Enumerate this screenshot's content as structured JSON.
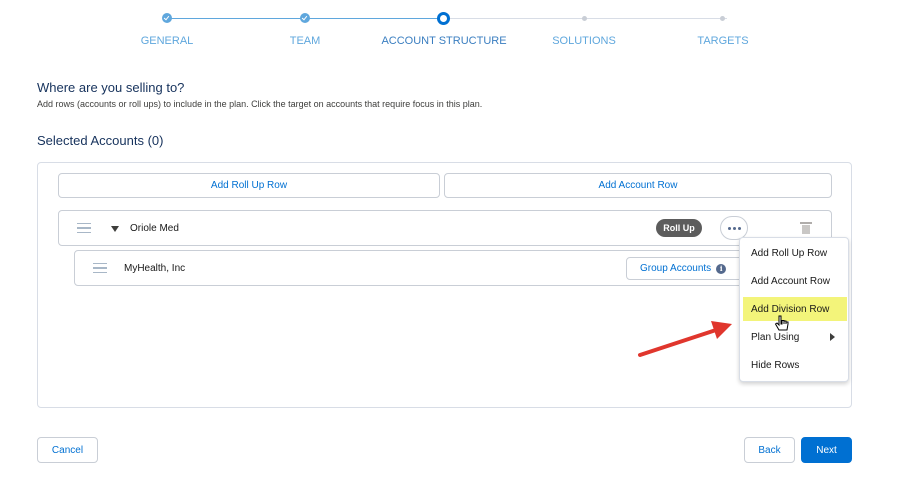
{
  "progress": {
    "steps": [
      {
        "label": "GENERAL",
        "state": "complete"
      },
      {
        "label": "TEAM",
        "state": "complete"
      },
      {
        "label": "ACCOUNT STRUCTURE",
        "state": "current"
      },
      {
        "label": "SOLUTIONS",
        "state": "incomplete"
      },
      {
        "label": "TARGETS",
        "state": "incomplete"
      }
    ]
  },
  "page": {
    "heading": "Where are you selling to?",
    "subtext": "Add rows (accounts or roll ups) to include in the plan. Click the target on accounts that require focus in this plan.",
    "selected_title": "Selected Accounts (0)"
  },
  "panel": {
    "add_rollup_label": "Add Roll Up Row",
    "add_account_label": "Add Account Row",
    "rows": [
      {
        "name": "Oriole Med",
        "badge": "Roll Up",
        "icon": "chevron-down-icon"
      },
      {
        "name": "MyHealth, Inc",
        "action": "Group Accounts",
        "icon": "info-icon"
      }
    ]
  },
  "menu": {
    "items": [
      {
        "label": "Add Roll Up Row"
      },
      {
        "label": "Add Account Row"
      },
      {
        "label": "Add Division Row",
        "highlighted": true
      },
      {
        "label": "Plan Using",
        "has_submenu": true
      },
      {
        "label": "Hide Rows"
      }
    ]
  },
  "footer": {
    "cancel_label": "Cancel",
    "back_label": "Back",
    "next_label": "Next"
  },
  "colors": {
    "brand": "#0070d2",
    "complete": "#5fa7dd",
    "highlight": "#f3f47a",
    "annotation_arrow": "#e0362d"
  }
}
